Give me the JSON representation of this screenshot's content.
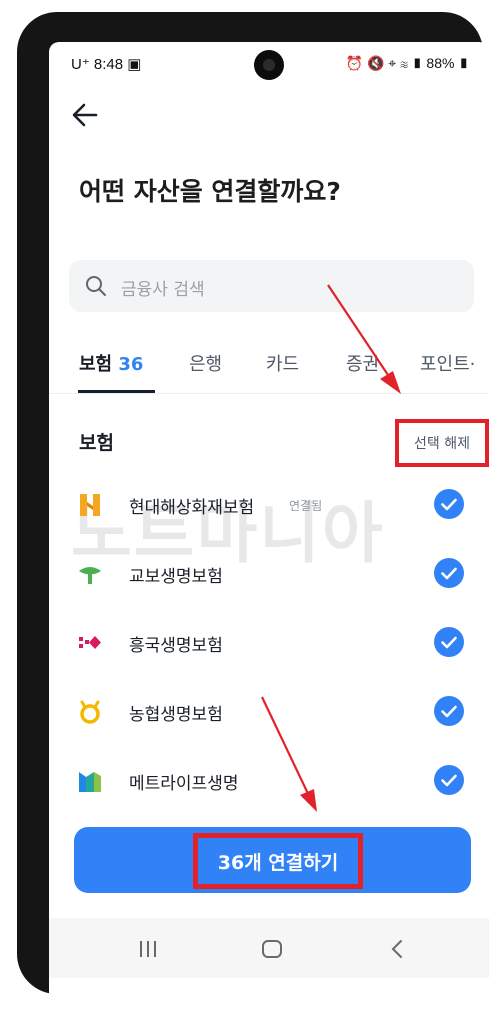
{
  "status_bar": {
    "carrier": "U⁺",
    "time": "8:48",
    "battery": "88%"
  },
  "header": {
    "title": "어떤 자산을 연결할까요?"
  },
  "search": {
    "placeholder": "금융사 검색"
  },
  "tabs": [
    {
      "label": "보험",
      "count": "36",
      "active": true
    },
    {
      "label": "은행"
    },
    {
      "label": "카드"
    },
    {
      "label": "증권"
    },
    {
      "label": "포인트·"
    }
  ],
  "section": {
    "title": "보험",
    "deselect_label": "선택 해제"
  },
  "insurers": [
    {
      "name": "현대해상화재보험",
      "tag": "연결됨",
      "icon": "hyundai-marine-logo",
      "selected": true
    },
    {
      "name": "교보생명보험",
      "tag": "",
      "icon": "kyobo-logo",
      "selected": true
    },
    {
      "name": "흥국생명보험",
      "tag": "",
      "icon": "heungkuk-logo",
      "selected": true
    },
    {
      "name": "농협생명보험",
      "tag": "",
      "icon": "nh-logo",
      "selected": true
    },
    {
      "name": "메트라이프생명",
      "tag": "",
      "icon": "metlife-logo",
      "selected": true
    }
  ],
  "watermark": "노트마니아",
  "cta": {
    "label": "36개 연결하기"
  },
  "colors": {
    "accent": "#3182f6",
    "annotation": "#e2222a"
  }
}
